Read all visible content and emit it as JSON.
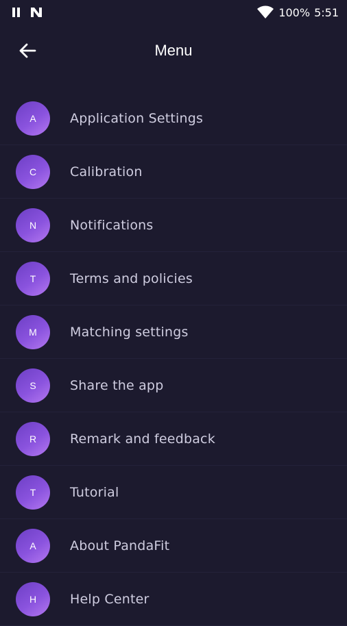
{
  "status_bar": {
    "battery": "100%",
    "time": "5:51"
  },
  "app_bar": {
    "title": "Menu",
    "back_icon": "arrow-left-icon"
  },
  "menu": {
    "items": [
      {
        "initial": "A",
        "label": "Application Settings"
      },
      {
        "initial": "C",
        "label": "Calibration"
      },
      {
        "initial": "N",
        "label": "Notifications"
      },
      {
        "initial": "T",
        "label": "Terms and policies"
      },
      {
        "initial": "M",
        "label": "Matching settings"
      },
      {
        "initial": "S",
        "label": "Share the app"
      },
      {
        "initial": "R",
        "label": "Remark and feedback"
      },
      {
        "initial": "T",
        "label": "Tutorial"
      },
      {
        "initial": "A",
        "label": "About PandaFit"
      },
      {
        "initial": "H",
        "label": "Help Center"
      }
    ]
  },
  "colors": {
    "background": "#1c1a2e",
    "avatar_gradient_start": "#6d3fc5",
    "avatar_gradient_end": "#b478f0",
    "label": "#cfcde0"
  }
}
